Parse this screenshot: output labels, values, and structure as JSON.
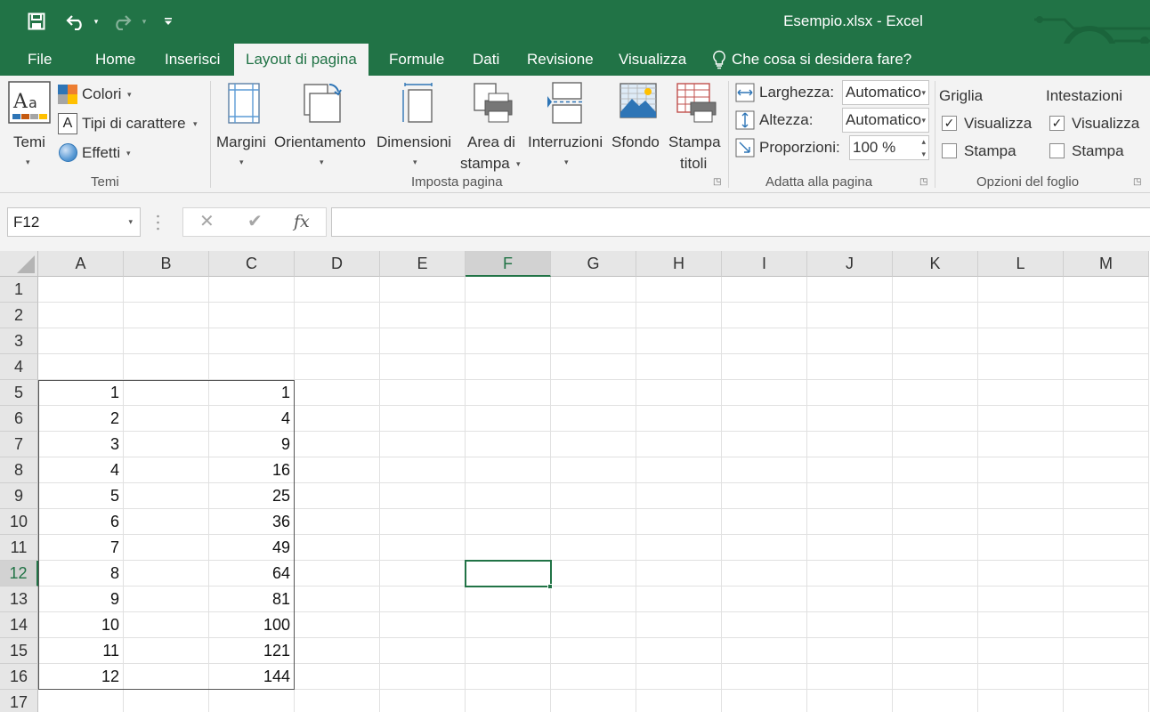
{
  "window": {
    "title": "Esempio.xlsx - Excel"
  },
  "colors": {
    "brand": "#217346",
    "ribbon_bg": "#f3f3f3"
  },
  "quick_access": {
    "icons": [
      "save-icon",
      "undo-icon",
      "redo-icon",
      "customize-icon"
    ]
  },
  "tabs": [
    {
      "label": "File"
    },
    {
      "label": "Home"
    },
    {
      "label": "Inserisci"
    },
    {
      "label": "Layout di pagina",
      "active": true
    },
    {
      "label": "Formule"
    },
    {
      "label": "Dati"
    },
    {
      "label": "Revisione"
    },
    {
      "label": "Visualizza"
    }
  ],
  "tell_me": {
    "label": "Che cosa si desidera fare?",
    "icon": "lightbulb-icon"
  },
  "ribbon": {
    "temi": {
      "group_label": "Temi",
      "temi_label": "Temi",
      "colori_label": "Colori",
      "tipi_label": "Tipi di carattere",
      "effetti_label": "Effetti"
    },
    "imposta_pagina": {
      "group_label": "Imposta pagina",
      "margini": "Margini",
      "orientamento": "Orientamento",
      "dimensioni": "Dimensioni",
      "area_line1": "Area di",
      "area_line2": "stampa",
      "interruzioni": "Interruzioni",
      "sfondo": "Sfondo",
      "stampa_line1": "Stampa",
      "stampa_line2": "titoli"
    },
    "adatta": {
      "group_label": "Adatta alla pagina",
      "larghezza_label": "Larghezza:",
      "larghezza_value": "Automatico",
      "altezza_label": "Altezza:",
      "altezza_value": "Automatico",
      "proporzioni_label": "Proporzioni:",
      "proporzioni_value": "100 %"
    },
    "opzioni": {
      "group_label": "Opzioni del foglio",
      "griglia_label": "Griglia",
      "intestazioni_label": "Intestazioni",
      "griglia_visualizza": "Visualizza",
      "griglia_stampa": "Stampa",
      "intestazioni_visualizza": "Visualizza",
      "intestazioni_stampa": "Stampa",
      "griglia_visualizza_checked": true,
      "griglia_stampa_checked": false,
      "intestazioni_visualizza_checked": true,
      "intestazioni_stampa_checked": false
    }
  },
  "formula_bar": {
    "name_box": "F12",
    "formula": "",
    "fx_label": "fx"
  },
  "sheet": {
    "columns": [
      "A",
      "B",
      "C",
      "D",
      "E",
      "F",
      "G",
      "H",
      "I",
      "J",
      "K",
      "L",
      "M"
    ],
    "rows": [
      "1",
      "2",
      "3",
      "4",
      "5",
      "6",
      "7",
      "8",
      "9",
      "10",
      "11",
      "12",
      "13",
      "14",
      "15",
      "16",
      "17"
    ],
    "selected_column": "F",
    "selected_row": "12",
    "col_a_values": [
      "",
      "",
      "",
      "",
      "1",
      "2",
      "3",
      "4",
      "5",
      "6",
      "7",
      "8",
      "9",
      "10",
      "11",
      "12",
      ""
    ],
    "col_c_values": [
      "",
      "",
      "",
      "",
      "1",
      "4",
      "9",
      "16",
      "25",
      "36",
      "49",
      "64",
      "81",
      "100",
      "121",
      "144",
      ""
    ]
  }
}
